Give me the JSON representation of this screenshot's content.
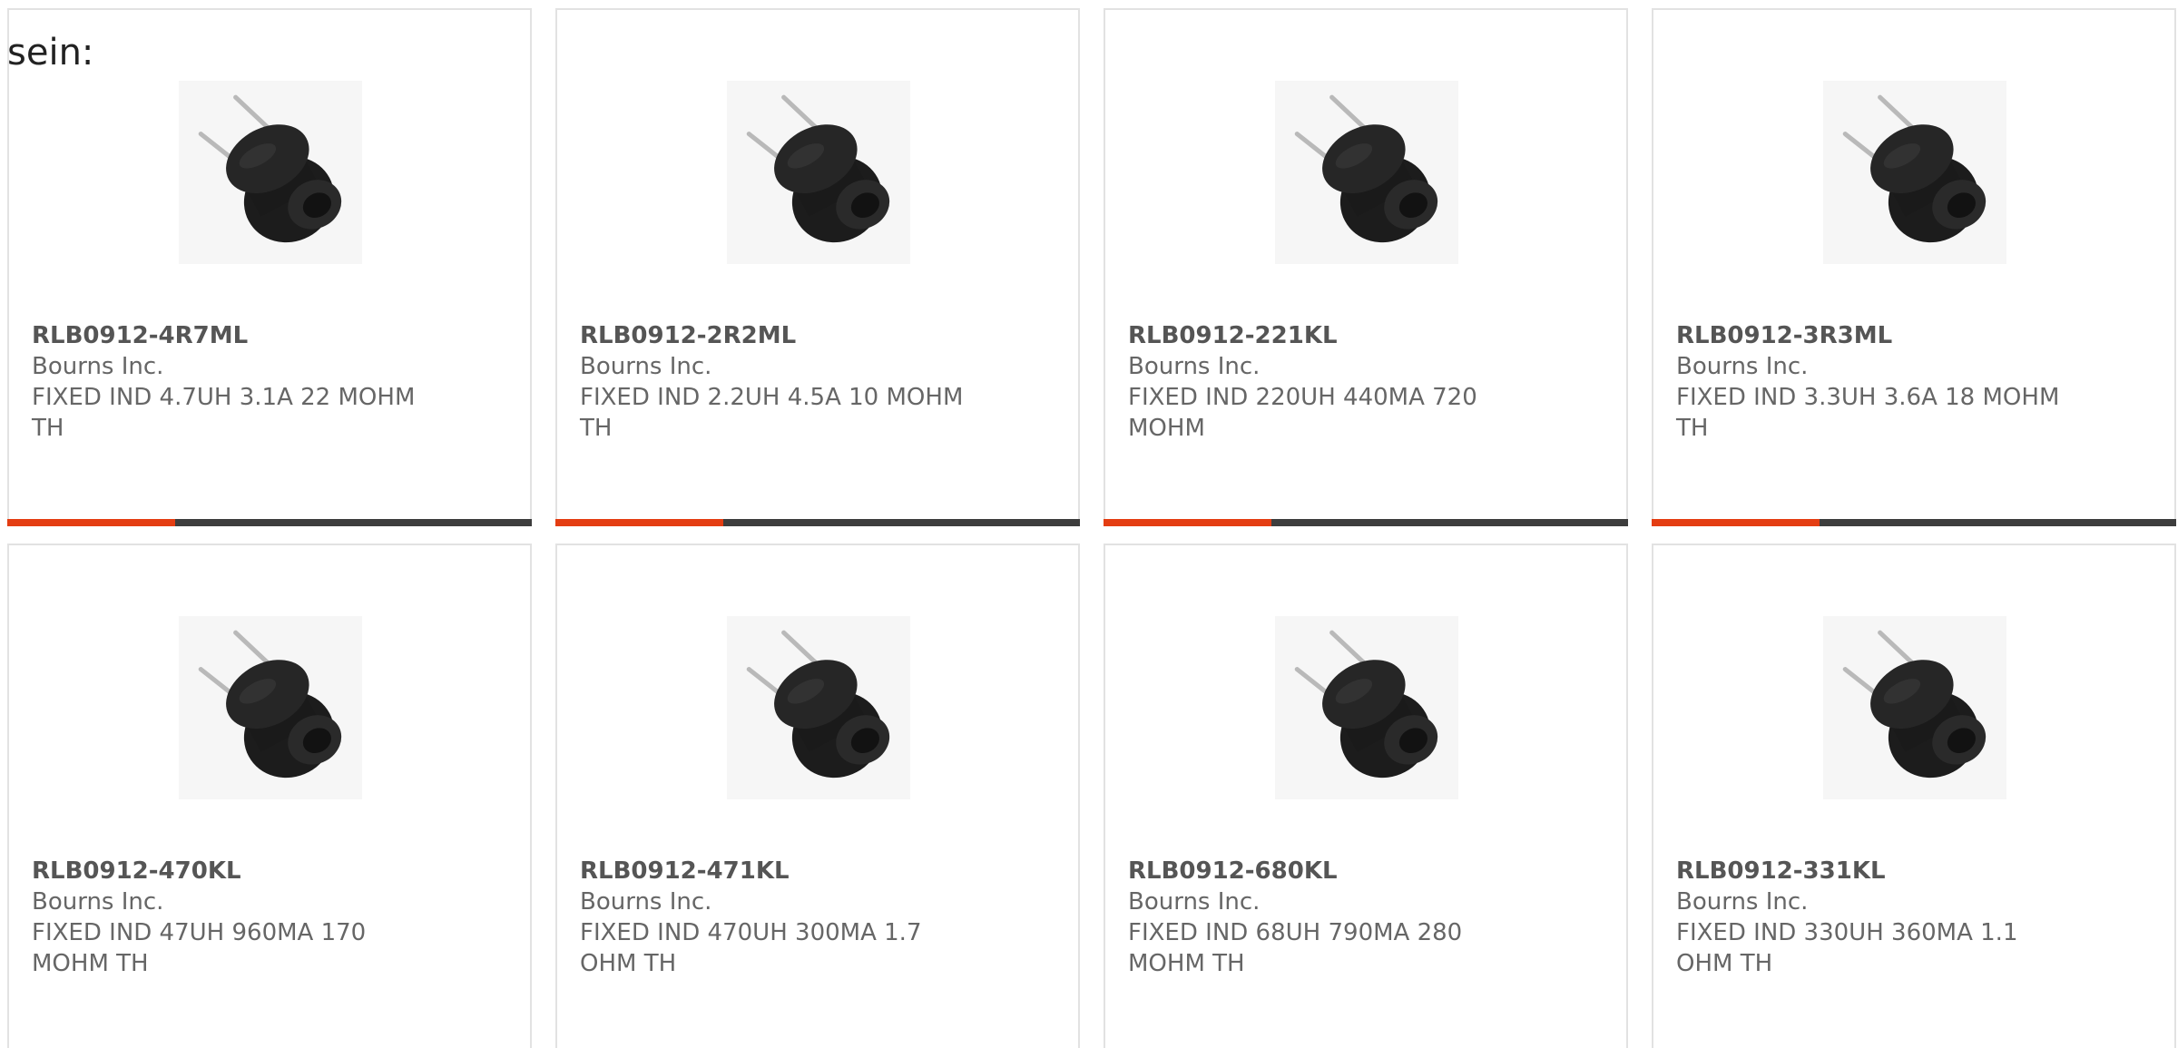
{
  "intro_text": "sein:",
  "colors": {
    "accent": "#e43d12",
    "bar": "#3d3d3d",
    "border": "#e2e2e2",
    "text": "#666666"
  },
  "product_icon": "inductor-image",
  "products": [
    {
      "part_number": "RLB0912-4R7ML",
      "manufacturer": "Bourns Inc.",
      "description": "FIXED IND 4.7UH 3.1A 22 MOHM TH",
      "accent_fraction": 0.32
    },
    {
      "part_number": "RLB0912-2R2ML",
      "manufacturer": "Bourns Inc.",
      "description": "FIXED IND 2.2UH 4.5A 10 MOHM TH",
      "accent_fraction": 0.32
    },
    {
      "part_number": "RLB0912-221KL",
      "manufacturer": "Bourns Inc.",
      "description": "FIXED IND 220UH 440MA 720 MOHM",
      "accent_fraction": 0.32
    },
    {
      "part_number": "RLB0912-3R3ML",
      "manufacturer": "Bourns Inc.",
      "description": "FIXED IND 3.3UH 3.6A 18 MOHM TH",
      "accent_fraction": 0.32
    },
    {
      "part_number": "RLB0912-470KL",
      "manufacturer": "Bourns Inc.",
      "description": "FIXED IND 47UH 960MA 170 MOHM TH"
    },
    {
      "part_number": "RLB0912-471KL",
      "manufacturer": "Bourns Inc.",
      "description": "FIXED IND 470UH 300MA 1.7 OHM TH"
    },
    {
      "part_number": "RLB0912-680KL",
      "manufacturer": "Bourns Inc.",
      "description": "FIXED IND 68UH 790MA 280 MOHM TH"
    },
    {
      "part_number": "RLB0912-331KL",
      "manufacturer": "Bourns Inc.",
      "description": "FIXED IND 330UH 360MA 1.1 OHM TH"
    }
  ]
}
